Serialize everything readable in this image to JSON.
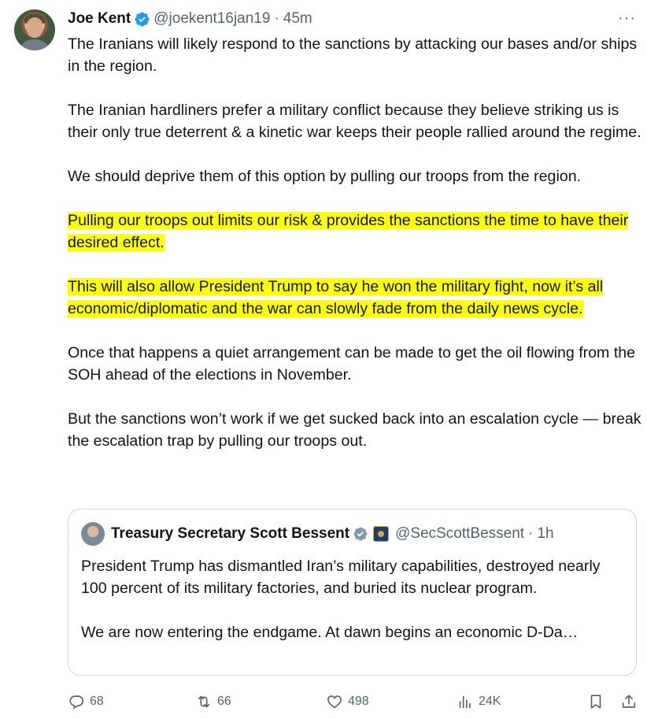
{
  "post": {
    "author_name": "Joe Kent",
    "handle": "@joekent16jan19",
    "separator": "·",
    "time": "45m",
    "more": "···",
    "paragraphs": [
      "The Iranians will likely respond to the sanctions by attacking our bases and/or ships in the region.",
      "The Iranian hardliners prefer a military conflict because they believe striking us is their only true deterrent & a kinetic war keeps  their people rallied around the regime.",
      "We should deprive them of this option by pulling our troops from the region.",
      "Pulling our troops out limits our risk & provides the sanctions the time to have their desired effect. ",
      "This will also allow President Trump to say he won the military fight, now it’s all economic/diplomatic and the war can slowly fade from the daily news cycle.",
      "Once that happens a quiet arrangement can be made to get the oil flowing from the SOH ahead of the elections in November.",
      "But the sanctions won’t work if we get sucked back into an escalation cycle — break the escalation trap by pulling our troops out."
    ]
  },
  "quote": {
    "author_name": "Treasury Secretary Scott Bessent",
    "handle": "@SecScottBessent",
    "separator": "·",
    "time": "1h",
    "paragraphs": [
      "President Trump has dismantled Iran’s military capabilities, destroyed nearly 100 percent of its military factories, and buried its nuclear program.",
      "We are now entering the endgame. At dawn begins an economic D-Da…"
    ]
  },
  "actions": {
    "replies": "68",
    "reposts": "66",
    "likes": "498",
    "views": "24K"
  },
  "colors": {
    "verified": "#1d9bf0",
    "quote_verified": "#829aab",
    "highlight": "#ffff00",
    "secondary_text": "#536471"
  },
  "icons": [
    "verified-badge-icon",
    "more-icon",
    "reply-icon",
    "repost-icon",
    "like-icon",
    "views-icon",
    "bookmark-icon",
    "share-icon"
  ]
}
